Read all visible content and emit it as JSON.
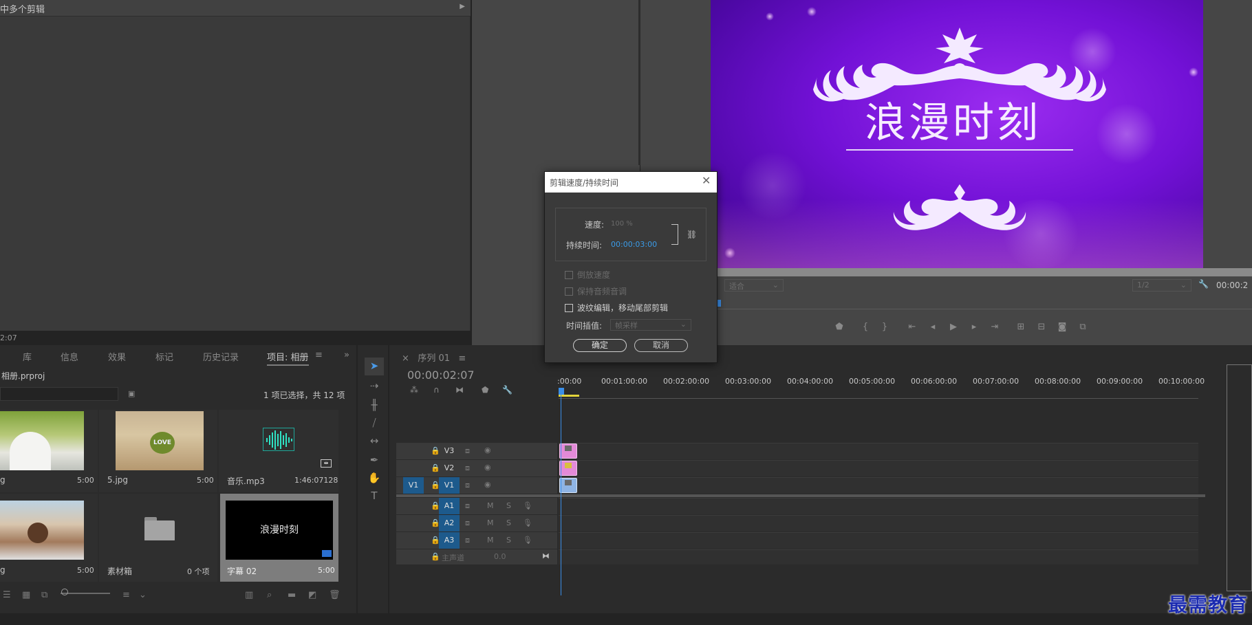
{
  "source": {
    "header_title": "中多个剪辑",
    "timecode": "2:07"
  },
  "program": {
    "video_title": "浪漫时刻",
    "fit_label": "适合",
    "quality_label": "1/2",
    "timecode": "00:00:2"
  },
  "project": {
    "tabs": [
      "库",
      "信息",
      "效果",
      "标记",
      "历史记录"
    ],
    "active_tab": "项目: 相册",
    "file_name": "相册.prproj",
    "selection_count": "1 项已选择，共 12 项",
    "items": [
      {
        "name": "g",
        "duration": "5:00"
      },
      {
        "name": "5.jpg",
        "duration": "5:00"
      },
      {
        "name": "音乐.mp3",
        "duration": "1:46:07128"
      },
      {
        "name": "g",
        "duration": "5:00"
      },
      {
        "name": "素材箱",
        "duration": "0 个项"
      },
      {
        "name": "字幕 02",
        "duration": "5:00",
        "thumb_text": "浪漫时刻"
      }
    ]
  },
  "timeline": {
    "tab_label": "序列 01",
    "timecode": "00:00:02:07",
    "ruler": [
      ":00:00",
      "00:01:00:00",
      "00:02:00:00",
      "00:03:00:00",
      "00:04:00:00",
      "00:05:00:00",
      "00:06:00:00",
      "00:07:00:00",
      "00:08:00:00",
      "00:09:00:00",
      "00:10:00:00"
    ],
    "video_tracks": [
      "V3",
      "V2",
      "V1"
    ],
    "audio_tracks": [
      "A1",
      "A2",
      "A3"
    ],
    "source_patch_v": "V1",
    "master_label": "主声道",
    "master_value": "0.0",
    "m_label": "M",
    "s_label": "S"
  },
  "dialog": {
    "title": "剪辑速度/持续时间",
    "speed_label": "速度:",
    "speed_value": "100 %",
    "duration_label": "持续时间:",
    "duration_value": "00:00:03:00",
    "options": [
      "倒放速度",
      "保持音频音调",
      "波纹编辑，移动尾部剪辑"
    ],
    "interp_label": "时间插值:",
    "interp_value": "帧采样",
    "ok_label": "确定",
    "cancel_label": "取消"
  },
  "watermark": "最需教育",
  "colors": {
    "accent": "#3a9be8",
    "track_patch": "#1d5a8c",
    "clip_pink": "#e38ad8",
    "clip_blue": "#8fb4e4"
  }
}
